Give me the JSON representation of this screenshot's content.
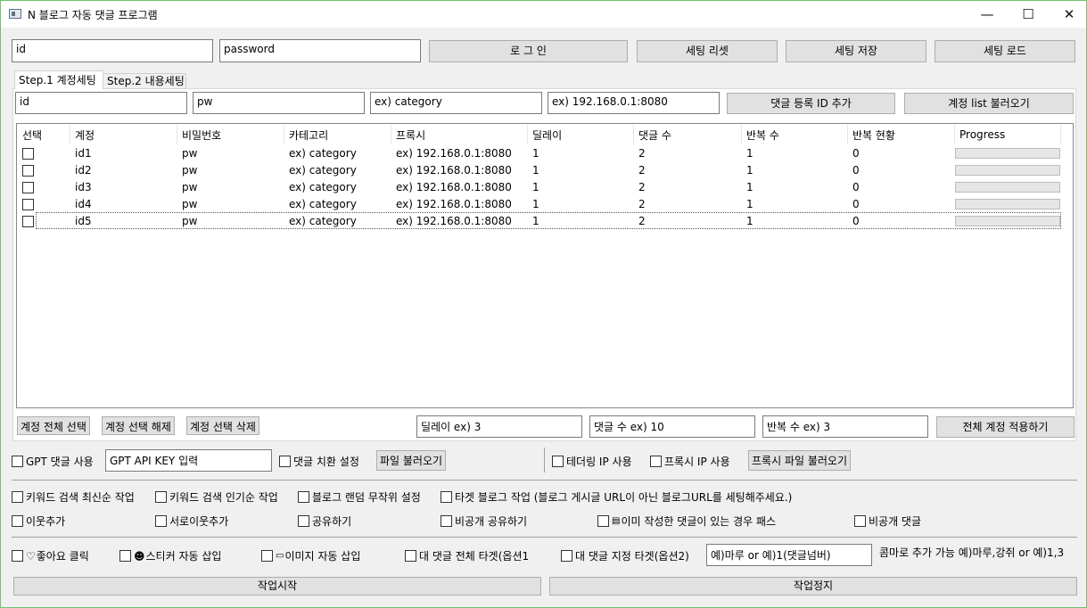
{
  "window": {
    "title": "N 블로그 자동 댓글 프로그램",
    "minimize": "—",
    "maximize": "☐",
    "close": "✕"
  },
  "login": {
    "id_value": "id",
    "password_value": "password",
    "login_label": "로 그 인",
    "reset_label": "세팅 리셋",
    "save_label": "세팅 저장",
    "load_label": "세팅 로드"
  },
  "tabs": [
    {
      "label": "Step.1 계정세팅"
    },
    {
      "label": "Step.2 내용세팅"
    }
  ],
  "account_input": {
    "id": "id",
    "pw": "pw",
    "category": "ex) category",
    "proxy": "ex) 192.168.0.1:8080",
    "add_label": "댓글 등록 ID 추가",
    "load_list_label": "계정 list 불러오기"
  },
  "table": {
    "columns": [
      "선택",
      "계정",
      "비밀번호",
      "카테고리",
      "프록시",
      "딜레이",
      "댓글 수",
      "반복 수",
      "반복 현황",
      "Progress"
    ],
    "rows": [
      {
        "account": "id1",
        "pw": "pw",
        "category": "ex) category",
        "proxy": "ex) 192.168.0.1:8080",
        "delay": "1",
        "comments": "2",
        "repeat": "1",
        "status": "0"
      },
      {
        "account": "id2",
        "pw": "pw",
        "category": "ex) category",
        "proxy": "ex) 192.168.0.1:8080",
        "delay": "1",
        "comments": "2",
        "repeat": "1",
        "status": "0"
      },
      {
        "account": "id3",
        "pw": "pw",
        "category": "ex) category",
        "proxy": "ex) 192.168.0.1:8080",
        "delay": "1",
        "comments": "2",
        "repeat": "1",
        "status": "0"
      },
      {
        "account": "id4",
        "pw": "pw",
        "category": "ex) category",
        "proxy": "ex) 192.168.0.1:8080",
        "delay": "1",
        "comments": "2",
        "repeat": "1",
        "status": "0"
      },
      {
        "account": "id5",
        "pw": "pw",
        "category": "ex) category",
        "proxy": "ex) 192.168.0.1:8080",
        "delay": "1",
        "comments": "2",
        "repeat": "1",
        "status": "0"
      }
    ]
  },
  "bulk": {
    "select_all": "계정 전체 선택",
    "deselect": "계정 선택 해제",
    "delete": "계정 선택 삭제",
    "delay": "딜레이 ex) 3",
    "comment_count": "댓글 수 ex) 10",
    "repeat_count": "반복 수 ex) 3",
    "apply_all": "전체 계정 적용하기"
  },
  "options": {
    "gpt_use": "GPT 댓글 사용",
    "gpt_key": "GPT API KEY 입력",
    "comment_replace": "댓글 치환 설정",
    "file_load": "파일 불러오기",
    "tethering": "테더링 IP 사용",
    "proxy_ip": "프록시 IP 사용",
    "proxy_file": "프록시 파일 불러오기",
    "kw_recent": "키워드 검색 최신순 작업",
    "kw_popular": "키워드 검색 인기순 작업",
    "blog_random": "블로그 랜덤 무작위 설정",
    "target_blog": "타겟 블로그 작업 (블로그 게시글 URL이 아닌 블로그URL를 세팅해주세요.)",
    "neighbor_add": "이웃추가",
    "mutual_neighbor": "서로이웃추가",
    "share": "공유하기",
    "private_share": "비공개 공유하기",
    "skip_commented": "이미 작성한 댓글이 있는 경우 패스",
    "private_comment": "비공개 댓글",
    "like_click": "좋아요 클릭",
    "sticker": "스티커 자동 삽입",
    "image": "이미지 자동 삽입",
    "reply_all": "대 댓글 전체 타겟(옵션1",
    "reply_target": "대 댓글 지정 타겟(옵션2)",
    "reply_input": "예)마루 or 예)1(댓글넘버)",
    "reply_note": "콤마로 추가 가능 예)마루,강쥐 or 예)1,3"
  },
  "actions": {
    "start": "작업시작",
    "stop": "작업정지"
  }
}
